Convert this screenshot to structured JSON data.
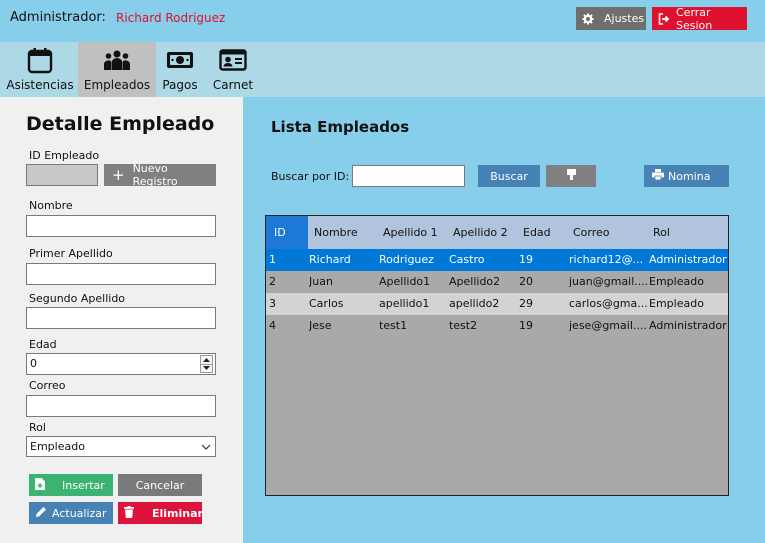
{
  "header": {
    "admin_label": "Administrador:",
    "admin_name": "Richard Rodriguez",
    "settings_label": "Ajustes",
    "logout_label": "Cerrar Sesion"
  },
  "nav": {
    "items": [
      {
        "label": "Asistencias",
        "icon": "calendar-icon"
      },
      {
        "label": "Empleados",
        "icon": "users-icon"
      },
      {
        "label": "Pagos",
        "icon": "money-icon"
      },
      {
        "label": "Carnet",
        "icon": "id-card-icon"
      }
    ]
  },
  "detail": {
    "title": "Detalle Empleado",
    "id_label": "ID Empleado",
    "new_record_label": "Nuevo Registro",
    "nombre_label": "Nombre",
    "nombre_value": "",
    "apellido1_label": "Primer Apellido",
    "apellido1_value": "",
    "apellido2_label": "Segundo Apellido",
    "apellido2_value": "",
    "edad_label": "Edad",
    "edad_value": "0",
    "correo_label": "Correo",
    "correo_value": "",
    "rol_label": "Rol",
    "rol_value": "Empleado",
    "insert_label": "Insertar",
    "cancel_label": "Cancelar",
    "update_label": "Actualizar",
    "delete_label": "Eliminar"
  },
  "list": {
    "title": "Lista Empleados",
    "search_label": "Buscar por ID:",
    "search_value": "",
    "search_button": "Buscar",
    "payroll_button": "Nomina",
    "columns": [
      "ID",
      "Nombre",
      "Apellido 1",
      "Apellido 2",
      "Edad",
      "Correo",
      "Rol"
    ],
    "rows": [
      [
        "1",
        "Richard",
        "Rodriguez",
        "Castro",
        "19",
        "richard12@...",
        "Administrador"
      ],
      [
        "2",
        "Juan",
        "Apellido1",
        "Apellido2",
        "20",
        "juan@gmail....",
        "Empleado"
      ],
      [
        "3",
        "Carlos",
        "apellido1",
        "apellido2",
        "29",
        "carlos@gma...",
        "Empleado"
      ],
      [
        "4",
        "Jese",
        "test1",
        "test2",
        "19",
        "jese@gmail....",
        "Administrador"
      ]
    ]
  },
  "colors": {
    "accent_red": "#E0102F",
    "selection_blue": "#0078D7",
    "button_blue": "#4682B4",
    "button_green": "#3CB371"
  }
}
